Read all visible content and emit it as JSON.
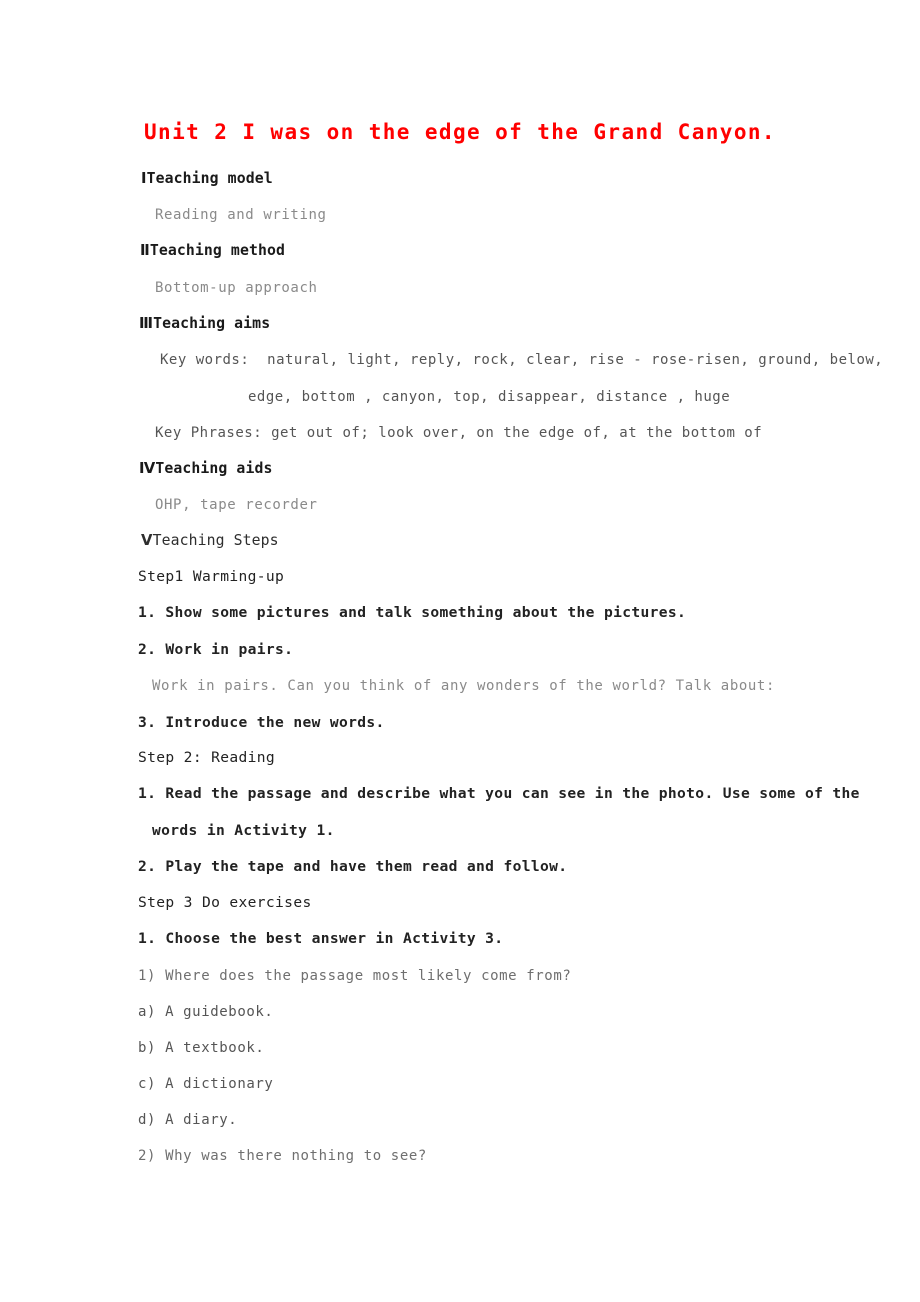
{
  "document": {
    "title": "Unit 2 I was on the edge of the Grand Canyon.",
    "title_color": "#ff0000",
    "page_background": "#ffffff"
  },
  "sections": [
    {
      "numeral": "Ⅰ",
      "heading": "Teaching model",
      "body": [
        "Reading and writing"
      ]
    },
    {
      "numeral": "Ⅱ",
      "heading": "Teaching method",
      "body": [
        "Bottom-up approach"
      ]
    },
    {
      "numeral": "Ⅲ",
      "heading": "Teaching aims",
      "body": [
        "Key words:  natural, light, reply, rock, clear, rise - rose-risen, ground, below,",
        "edge, bottom , canyon, top, disappear, distance , huge",
        "Key Phrases: get out of; look over, on the edge of, at the bottom of"
      ]
    },
    {
      "numeral": "Ⅳ",
      "heading": "Teaching aids",
      "body": [
        "OHP, tape recorder"
      ]
    },
    {
      "numeral": "Ⅴ",
      "heading": "Teaching Steps",
      "body": []
    }
  ],
  "steps": [
    {
      "header": "Step1 Warming-up",
      "items": [
        "1. Show some pictures and talk something about the pictures.",
        "2. Work in pairs.",
        "Work in pairs. Can you think of any wonders of the world? Talk about:",
        "3. Introduce the new words."
      ]
    },
    {
      "header": "Step 2: Reading",
      "items": [
        "1. Read the passage and describe what you can see in the photo. Use some of the",
        "words in Activity 1.",
        "2. Play the tape and have them read and follow."
      ]
    },
    {
      "header": "Step 3 Do exercises",
      "items": [
        "1. Choose the best answer in Activity 3."
      ]
    }
  ],
  "exercise": {
    "question1": "1) Where does the passage most likely come from?",
    "options": [
      "a) A guidebook.",
      "b) A textbook.",
      "c) A dictionary",
      "d) A diary."
    ],
    "question2": "2) Why was there nothing to see?"
  },
  "lines": {
    "l_sec1_num": "Ⅰ",
    "l_sec1_head": "Teaching model",
    "l_sec1_b0": "Reading and writing",
    "l_sec2_num": "Ⅱ",
    "l_sec2_head": "Teaching method",
    "l_sec2_b0": "Bottom-up approach",
    "l_sec3_num": "Ⅲ",
    "l_sec3_head": "Teaching aims",
    "l_sec3_b0": "Key words:  natural, light, reply, rock, clear, rise - rose-risen, ground, below,",
    "l_sec3_b1": "edge, bottom , canyon, top, disappear, distance , huge",
    "l_sec3_b2": "Key Phrases: get out of; look over, on the edge of, at the bottom of",
    "l_sec4_num": "Ⅳ",
    "l_sec4_head": "Teaching aids",
    "l_sec4_b0": "OHP, tape recorder",
    "l_sec5_num": "Ⅴ",
    "l_sec5_head": "Teaching Steps",
    "l_step1_head": "Step1 Warming-up",
    "l_step1_i0": "1. Show some pictures and talk something about the pictures.",
    "l_step1_i1": "2. Work in pairs.",
    "l_step1_i2": "Work in pairs. Can you think of any wonders of the world? Talk about:",
    "l_step1_i3": "3. Introduce the new words.",
    "l_step2_head": "Step 2: Reading",
    "l_step2_i0": "1. Read the passage and describe what you can see in the photo. Use some of the",
    "l_step2_i1": "words in Activity 1.",
    "l_step2_i2": "2. Play the tape and have them read and follow.",
    "l_step3_head": "Step 3 Do exercises",
    "l_step3_i0": "1. Choose the best answer in Activity 3.",
    "l_q1": "1) Where does the passage most likely come from?",
    "l_opt_a": "a) A guidebook.",
    "l_opt_b": "b) A textbook.",
    "l_opt_c": "c) A dictionary",
    "l_opt_d": "d) A diary.",
    "l_q2": "2) Why was there nothing to see?"
  }
}
